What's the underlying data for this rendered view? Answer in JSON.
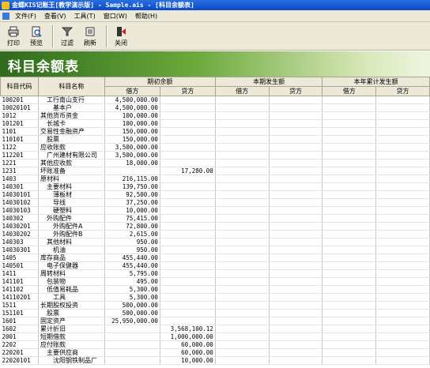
{
  "window": {
    "title": "金蝶KIS记账王[教学演示版] - Sample.ais - [科目余额表]"
  },
  "menu": [
    "文件(F)",
    "查看(V)",
    "工具(T)",
    "窗口(W)",
    "帮助(H)"
  ],
  "toolbar": [
    {
      "label": "打印",
      "icon": "printer-icon"
    },
    {
      "label": "预览",
      "icon": "preview-icon"
    },
    {
      "label": "过滤",
      "icon": "filter-icon"
    },
    {
      "label": "刷新",
      "icon": "refresh-icon"
    },
    {
      "label": "关闭",
      "icon": "close-icon"
    }
  ],
  "report_title": "科目余额表",
  "columns": {
    "code": "科目代码",
    "name": "科目名称",
    "groups": [
      "期初余额",
      "本期发生额",
      "本年累计发生额"
    ],
    "debit": "借方",
    "credit": "贷方"
  },
  "rows": [
    [
      "100201",
      "工行南山支行",
      "4,500,000.00",
      ""
    ],
    [
      "10020101",
      "基本户",
      "4,500,000.00",
      ""
    ],
    [
      "1012",
      "其他货币资金",
      "100,000.00",
      ""
    ],
    [
      "101201",
      "长城卡",
      "100,000.00",
      ""
    ],
    [
      "1101",
      "交易性金融资产",
      "150,000.00",
      ""
    ],
    [
      "110101",
      "股票",
      "150,000.00",
      ""
    ],
    [
      "1122",
      "应收账款",
      "3,500,000.00",
      ""
    ],
    [
      "112201",
      "广州建材有限公司",
      "3,500,000.00",
      ""
    ],
    [
      "1221",
      "其他应收款",
      "18,000.00",
      ""
    ],
    [
      "1231",
      "坏账准备",
      "",
      "17,280.00"
    ],
    [
      "1403",
      "原材料",
      "216,115.00",
      ""
    ],
    [
      "140301",
      "主要材料",
      "139,750.00",
      ""
    ],
    [
      "14030101",
      "薄板材",
      "92,500.00",
      ""
    ],
    [
      "14030102",
      "导线",
      "37,250.00",
      ""
    ],
    [
      "14030103",
      "硬塑料",
      "10,000.00",
      ""
    ],
    [
      "140302",
      "外购配件",
      "75,415.00",
      ""
    ],
    [
      "14030201",
      "外购配件A",
      "72,800.00",
      ""
    ],
    [
      "14030202",
      "外购配件B",
      "2,615.00",
      ""
    ],
    [
      "140303",
      "其他材料",
      "950.00",
      ""
    ],
    [
      "14030301",
      "机油",
      "950.00",
      ""
    ],
    [
      "1405",
      "库存商品",
      "455,440.00",
      ""
    ],
    [
      "140501",
      "电子保健器",
      "455,440.00",
      ""
    ],
    [
      "1411",
      "周转材料",
      "5,795.00",
      ""
    ],
    [
      "141101",
      "包装物",
      "495.00",
      ""
    ],
    [
      "141102",
      "低值易耗品",
      "5,300.00",
      ""
    ],
    [
      "14110201",
      "工具",
      "5,300.00",
      ""
    ],
    [
      "1511",
      "长期股权投资",
      "500,000.00",
      ""
    ],
    [
      "151101",
      "股票",
      "500,000.00",
      ""
    ],
    [
      "1601",
      "固定资产",
      "25,950,000.00",
      ""
    ],
    [
      "1602",
      "累计折旧",
      "",
      "3,568,100.12"
    ],
    [
      "2001",
      "短期借款",
      "",
      "1,000,000.00"
    ],
    [
      "2202",
      "应付账款",
      "",
      "60,000.00"
    ],
    [
      "220201",
      "主要供应商",
      "",
      "60,000.00"
    ],
    [
      "22020101",
      "沈阳钢铁制品厂",
      "",
      "10,000.00"
    ]
  ]
}
